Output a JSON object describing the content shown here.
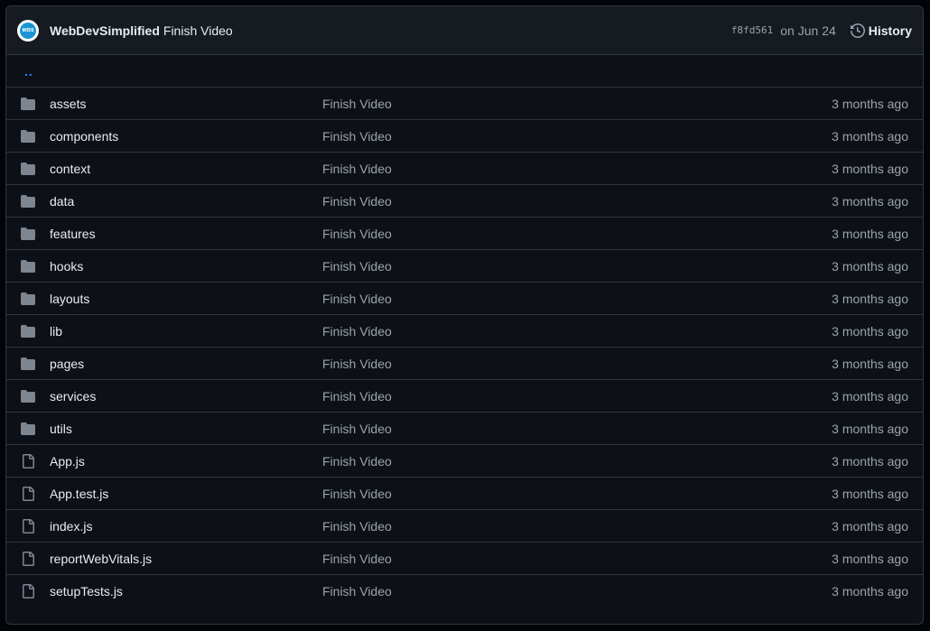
{
  "header": {
    "avatar_text": "WDS",
    "author": "WebDevSimplified",
    "commit_message": "Finish Video",
    "sha": "f8fd561",
    "date": "on Jun 24",
    "history_label": "History"
  },
  "parent_link": "..",
  "entries": [
    {
      "type": "folder",
      "name": "assets",
      "message": "Finish Video",
      "age": "3 months ago"
    },
    {
      "type": "folder",
      "name": "components",
      "message": "Finish Video",
      "age": "3 months ago"
    },
    {
      "type": "folder",
      "name": "context",
      "message": "Finish Video",
      "age": "3 months ago"
    },
    {
      "type": "folder",
      "name": "data",
      "message": "Finish Video",
      "age": "3 months ago"
    },
    {
      "type": "folder",
      "name": "features",
      "message": "Finish Video",
      "age": "3 months ago"
    },
    {
      "type": "folder",
      "name": "hooks",
      "message": "Finish Video",
      "age": "3 months ago"
    },
    {
      "type": "folder",
      "name": "layouts",
      "message": "Finish Video",
      "age": "3 months ago"
    },
    {
      "type": "folder",
      "name": "lib",
      "message": "Finish Video",
      "age": "3 months ago"
    },
    {
      "type": "folder",
      "name": "pages",
      "message": "Finish Video",
      "age": "3 months ago"
    },
    {
      "type": "folder",
      "name": "services",
      "message": "Finish Video",
      "age": "3 months ago"
    },
    {
      "type": "folder",
      "name": "utils",
      "message": "Finish Video",
      "age": "3 months ago"
    },
    {
      "type": "file",
      "name": "App.js",
      "message": "Finish Video",
      "age": "3 months ago"
    },
    {
      "type": "file",
      "name": "App.test.js",
      "message": "Finish Video",
      "age": "3 months ago"
    },
    {
      "type": "file",
      "name": "index.js",
      "message": "Finish Video",
      "age": "3 months ago"
    },
    {
      "type": "file",
      "name": "reportWebVitals.js",
      "message": "Finish Video",
      "age": "3 months ago"
    },
    {
      "type": "file",
      "name": "setupTests.js",
      "message": "Finish Video",
      "age": "3 months ago"
    }
  ],
  "colors": {
    "folder": "#7d8590",
    "link": "#2f81f7",
    "background": "#0d1117",
    "header": "#161b22",
    "border": "#30363d"
  },
  "icons": {
    "folder": "folder-icon",
    "file": "file-icon",
    "history": "history-icon"
  }
}
